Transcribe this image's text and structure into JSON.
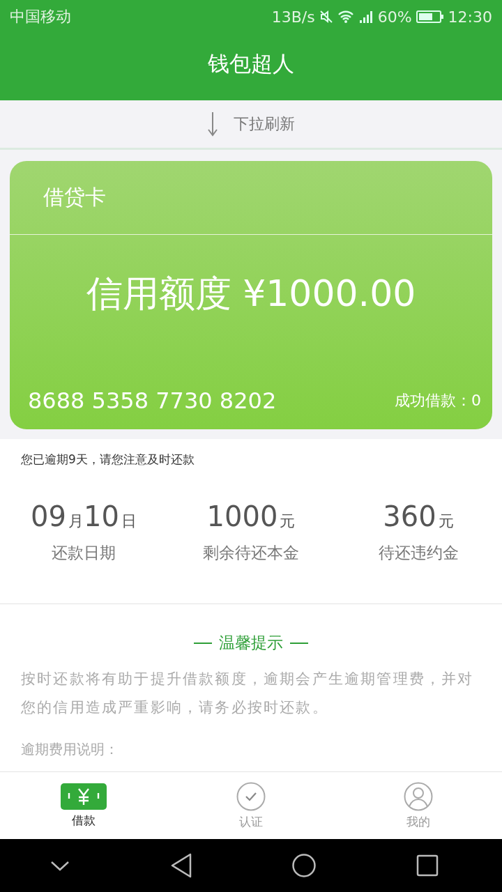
{
  "status_bar": {
    "carrier": "中国移动",
    "speed": "13B/s",
    "battery": "60%",
    "time": "12:30"
  },
  "header": {
    "title": "钱包超人"
  },
  "pull_refresh": {
    "label": "下拉刷新"
  },
  "card": {
    "type": "借贷卡",
    "limit": "信用额度 ¥1000.00",
    "number": "8688 5358 7730 8202",
    "success": "成功借款：0"
  },
  "notice": "您已逾期9天，请您注意及时还款",
  "stats": [
    {
      "value": [
        {
          "text": "09",
          "kind": "number"
        },
        {
          "text": "月",
          "kind": "unit"
        },
        {
          "text": "10",
          "kind": "number"
        },
        {
          "text": "日",
          "kind": "unit"
        }
      ],
      "label": "还款日期"
    },
    {
      "value": [
        {
          "text": "1000",
          "kind": "number"
        },
        {
          "text": "元",
          "kind": "unit"
        }
      ],
      "label": "剩余待还本金"
    },
    {
      "value": [
        {
          "text": "360",
          "kind": "number"
        },
        {
          "text": "元",
          "kind": "unit"
        }
      ],
      "label": "待还违约金"
    }
  ],
  "tips": {
    "title": "温馨提示",
    "body": "按时还款将有助于提升借款额度，逾期会产生逾期管理费，并对您的信用造成严重影响，请务必按时还款。",
    "subheading": "逾期费用说明："
  },
  "tabs": [
    {
      "label": "借款",
      "kind": "money",
      "selected": true
    },
    {
      "label": "认证",
      "kind": "check",
      "selected": false
    },
    {
      "label": "我的",
      "kind": "user",
      "selected": false
    }
  ]
}
